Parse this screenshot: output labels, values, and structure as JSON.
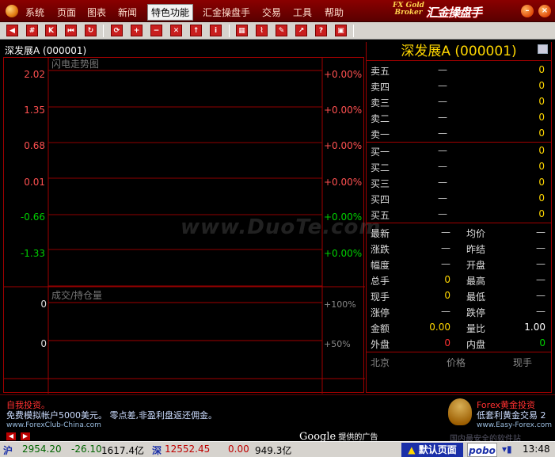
{
  "menu": {
    "items": [
      "系统",
      "页面",
      "图表",
      "新闻",
      "特色功能",
      "汇金操盘手",
      "交易",
      "工具",
      "帮助"
    ],
    "active_index": 4,
    "brand_en": "FX Gold Broker",
    "brand_cn": "汇金操盘手"
  },
  "chart": {
    "header": "深发展A (000001)",
    "price_panel_title": "闪电走势图",
    "price_labels": [
      "2.02",
      "1.35",
      "0.68",
      "0.01",
      "-0.66",
      "-1.33"
    ],
    "pct_labels": [
      "+0.00%",
      "+0.00%",
      "+0.00%",
      "+0.00%",
      "+0.00%",
      "+0.00%"
    ],
    "price_colors": [
      "#ff5050",
      "#ff5050",
      "#ff5050",
      "#ff5050",
      "#00d000",
      "#00d000"
    ],
    "volume_panel_title": "成交/持仓量",
    "volume_labels": [
      "0",
      "0"
    ],
    "volume_pct_labels": [
      "+100%",
      "+50%"
    ]
  },
  "quote": {
    "title": "深发展A (000001)",
    "sells": [
      {
        "label": "卖五",
        "price": "—",
        "vol": "0"
      },
      {
        "label": "卖四",
        "price": "—",
        "vol": "0"
      },
      {
        "label": "卖三",
        "price": "—",
        "vol": "0"
      },
      {
        "label": "卖二",
        "price": "—",
        "vol": "0"
      },
      {
        "label": "卖一",
        "price": "—",
        "vol": "0"
      }
    ],
    "buys": [
      {
        "label": "买一",
        "price": "—",
        "vol": "0"
      },
      {
        "label": "买二",
        "price": "—",
        "vol": "0"
      },
      {
        "label": "买三",
        "price": "—",
        "vol": "0"
      },
      {
        "label": "买四",
        "price": "—",
        "vol": "0"
      },
      {
        "label": "买五",
        "price": "—",
        "vol": "0"
      }
    ],
    "stats": [
      {
        "l1": "最新",
        "v1": "—",
        "c1": "#cccccc",
        "l2": "均价",
        "v2": "—",
        "c2": "#cccccc"
      },
      {
        "l1": "涨跌",
        "v1": "—",
        "c1": "#cccccc",
        "l2": "昨结",
        "v2": "—",
        "c2": "#cccccc"
      },
      {
        "l1": "幅度",
        "v1": "—",
        "c1": "#cccccc",
        "l2": "开盘",
        "v2": "—",
        "c2": "#cccccc"
      },
      {
        "l1": "总手",
        "v1": "0",
        "c1": "#ffd700",
        "l2": "最高",
        "v2": "—",
        "c2": "#cccccc"
      },
      {
        "l1": "现手",
        "v1": "0",
        "c1": "#ffd700",
        "l2": "最低",
        "v2": "—",
        "c2": "#cccccc"
      },
      {
        "l1": "涨停",
        "v1": "—",
        "c1": "#cccccc",
        "l2": "跌停",
        "v2": "—",
        "c2": "#cccccc"
      },
      {
        "l1": "金额",
        "v1": "0.00",
        "c1": "#ffd700",
        "l2": "量比",
        "v2": "1.00",
        "c2": "#ffffff"
      },
      {
        "l1": "外盘",
        "v1": "0",
        "c1": "#ff3030",
        "l2": "内盘",
        "v2": "0",
        "c2": "#00d000"
      }
    ],
    "trade_headers": [
      "北京",
      "价格",
      "现手"
    ]
  },
  "ads": {
    "left_line1": "自我投资。",
    "left_line2": "免费模拟帐户5000美元。 零点差,非盈利盘返还佣金。",
    "left_url": "www.ForexClub-China.com",
    "google": "Google",
    "google_suffix": "提供的广告",
    "right_line1": "Forex黄金投资",
    "right_line2": "低套利黄金交易 2",
    "right_url": "www.Easy-Forex.com",
    "watermark_right": "国内最安全的软件站"
  },
  "status": {
    "sh_label": "沪",
    "sh_index": "2954.20",
    "sh_change": "-26.10",
    "sh_amount": "1617.4亿",
    "sz_label": "深",
    "sz_index": "12552.45",
    "sz_change": "0.00",
    "sz_amount": "949.3亿",
    "default_page": "默认页面",
    "pobo": "pobo",
    "time": "13:48"
  },
  "watermark": "www.DuoTe.com",
  "colors": {
    "up": "#ff5050",
    "down": "#00d000",
    "grid": "#a00000",
    "highlight": "#ffd700"
  }
}
